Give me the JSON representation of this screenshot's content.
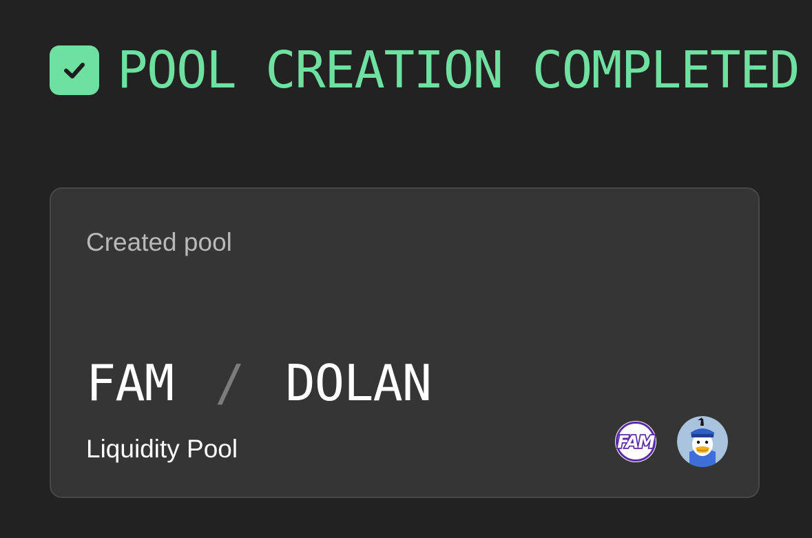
{
  "header": {
    "icon": "check-icon",
    "title": "POOL CREATION COMPLETED",
    "accent_color": "#6ee0a0"
  },
  "card": {
    "label": "Created pool",
    "pair": {
      "token_a": "FAM",
      "separator": "/",
      "token_b": "DOLAN"
    },
    "pool_type": "Liquidity Pool",
    "token_icons": [
      {
        "name": "fam-token-icon",
        "logo_text": "FAM"
      },
      {
        "name": "dolan-token-icon"
      }
    ]
  }
}
